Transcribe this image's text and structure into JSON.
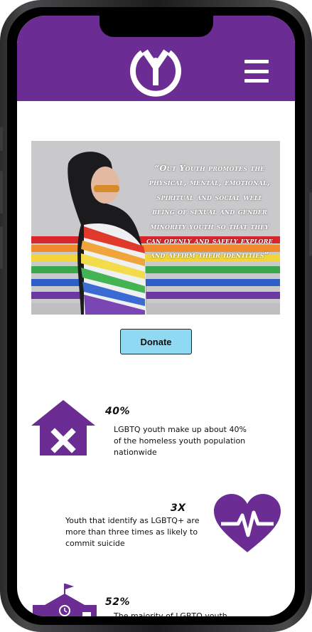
{
  "brand": {
    "primary": "#6b2d93",
    "button": "#8fdaf2"
  },
  "header": {
    "logo_icon": "y-circle-logo",
    "menu_icon": "hamburger-icon"
  },
  "hero": {
    "quote": "“Out Youth promotes the physical, mental, emotional, spiritual and social well being of sexual and gender minority youth so that they can openly and safely explore and affirm their identities”"
  },
  "donate": {
    "label": "Donate"
  },
  "stats": [
    {
      "icon": "house-x-icon",
      "value": "40%",
      "text": "LGBTQ youth make up about 40% of the homeless youth population nationwide"
    },
    {
      "icon": "heart-pulse-icon",
      "value": "3X",
      "text": "Youth that identify as LGBTQ+ are more than three times as likely to commit suicide"
    },
    {
      "icon": "school-icon",
      "value": "52%",
      "text": "The majority of LGBTQ youth enrolled"
    }
  ]
}
